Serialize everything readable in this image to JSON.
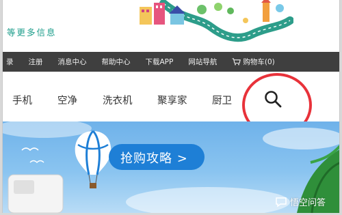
{
  "header": {
    "tagline": "等更多信息"
  },
  "topnav": {
    "items": [
      "录",
      "注册",
      "消息中心",
      "帮助中心",
      "下载APP",
      "网站导航"
    ],
    "cart_label": "购物车(0)"
  },
  "categories": [
    "手机",
    "空净",
    "洗衣机",
    "聚享家",
    "厨卫"
  ],
  "hero": {
    "banner_text": "抢购攻略 >"
  },
  "watermark": {
    "text": "悟空问答"
  },
  "colors": {
    "accent_teal": "#1c9d8b",
    "nav_bg": "#3f3f3f",
    "highlight_red": "#e8323a",
    "hero_blue": "#1e7fd6"
  },
  "icons": [
    "search-icon",
    "cart-icon",
    "hot-air-balloon-icon",
    "chat-bubble-icon"
  ]
}
